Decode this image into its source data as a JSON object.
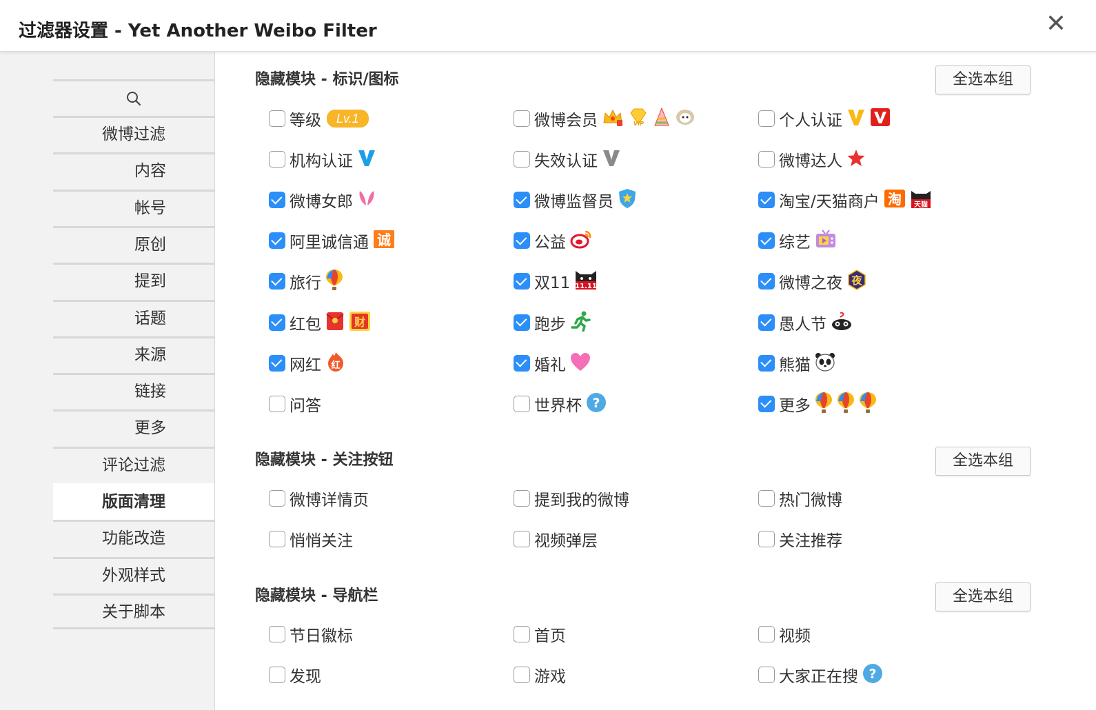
{
  "window": {
    "title": "过滤器设置 - Yet Another Weibo Filter",
    "close_label": "✕"
  },
  "sidebar": {
    "search_icon": "search-icon",
    "items": [
      {
        "label": "微博过滤",
        "level": "top",
        "active": false
      },
      {
        "label": "内容",
        "level": "sub",
        "active": false
      },
      {
        "label": "帐号",
        "level": "sub",
        "active": false
      },
      {
        "label": "原创",
        "level": "sub",
        "active": false
      },
      {
        "label": "提到",
        "level": "sub",
        "active": false
      },
      {
        "label": "话题",
        "level": "sub",
        "active": false
      },
      {
        "label": "来源",
        "level": "sub",
        "active": false
      },
      {
        "label": "链接",
        "level": "sub",
        "active": false
      },
      {
        "label": "更多",
        "level": "sub",
        "active": false
      },
      {
        "label": "评论过滤",
        "level": "top",
        "active": false
      },
      {
        "label": "版面清理",
        "level": "top",
        "active": true
      },
      {
        "label": "功能改造",
        "level": "top",
        "active": false
      },
      {
        "label": "外观样式",
        "level": "top",
        "active": false
      },
      {
        "label": "关于脚本",
        "level": "top",
        "active": false
      }
    ]
  },
  "groups": [
    {
      "title": "隐藏模块 - 标识/图标",
      "select_all_label": "全选本组",
      "options": [
        {
          "label": "等级",
          "checked": false,
          "badge": "Lv.1"
        },
        {
          "label": "微博会员",
          "checked": false,
          "icons": [
            "crown-icon",
            "vip-diamond-icon",
            "party-hat-icon",
            "sheep-icon"
          ]
        },
        {
          "label": "个人认证",
          "checked": false,
          "icons": [
            "verified-v-yellow-icon",
            "verified-v-red-icon"
          ]
        },
        {
          "label": "机构认证",
          "checked": false,
          "icons": [
            "verified-v-blue-icon"
          ]
        },
        {
          "label": "失效认证",
          "checked": false,
          "icons": [
            "verified-v-gray-icon"
          ]
        },
        {
          "label": "微博达人",
          "checked": false,
          "icons": [
            "star-icon"
          ]
        },
        {
          "label": "微博女郎",
          "checked": true,
          "icons": [
            "bunny-ears-icon"
          ]
        },
        {
          "label": "微博监督员",
          "checked": true,
          "icons": [
            "shield-star-icon"
          ]
        },
        {
          "label": "淘宝/天猫商户",
          "checked": true,
          "icons": [
            "taobao-icon",
            "tmall-icon"
          ],
          "icon_text": [
            "淘",
            "天猫"
          ]
        },
        {
          "label": "阿里诚信通",
          "checked": true,
          "icons": [
            "chengxin-icon"
          ],
          "icon_text": [
            "诚"
          ]
        },
        {
          "label": "公益",
          "checked": true,
          "icons": [
            "weibo-logo-icon"
          ]
        },
        {
          "label": "综艺",
          "checked": true,
          "icons": [
            "tv-icon"
          ]
        },
        {
          "label": "旅行",
          "checked": true,
          "icons": [
            "balloon-icon"
          ]
        },
        {
          "label": "双11",
          "checked": true,
          "icons": [
            "double11-cat-icon"
          ],
          "icon_text": [
            "11.11"
          ]
        },
        {
          "label": "微博之夜",
          "checked": true,
          "icons": [
            "night-icon"
          ],
          "icon_text": [
            "夜"
          ]
        },
        {
          "label": "红包",
          "checked": true,
          "icons": [
            "red-envelope-icon",
            "cai-icon"
          ],
          "icon_text": [
            "财"
          ]
        },
        {
          "label": "跑步",
          "checked": true,
          "icons": [
            "runner-icon"
          ]
        },
        {
          "label": "愚人节",
          "checked": true,
          "icons": [
            "april-fools-icon"
          ]
        },
        {
          "label": "网红",
          "checked": true,
          "icons": [
            "wanghong-icon"
          ],
          "icon_text": [
            "红"
          ]
        },
        {
          "label": "婚礼",
          "checked": true,
          "icons": [
            "heart-icon"
          ]
        },
        {
          "label": "熊猫",
          "checked": true,
          "icons": [
            "panda-icon"
          ]
        },
        {
          "label": "问答",
          "checked": false,
          "icons": []
        },
        {
          "label": "世界杯",
          "checked": false,
          "icons": [
            "help-icon"
          ],
          "icon_text": [
            "?"
          ]
        },
        {
          "label": "更多",
          "checked": true,
          "icons": [
            "balloon-icon",
            "balloon-icon",
            "balloon-icon"
          ]
        }
      ]
    },
    {
      "title": "隐藏模块 - 关注按钮",
      "select_all_label": "全选本组",
      "options": [
        {
          "label": "微博详情页",
          "checked": false,
          "icons": []
        },
        {
          "label": "提到我的微博",
          "checked": false,
          "icons": []
        },
        {
          "label": "热门微博",
          "checked": false,
          "icons": []
        },
        {
          "label": "悄悄关注",
          "checked": false,
          "icons": []
        },
        {
          "label": "视频弹层",
          "checked": false,
          "icons": []
        },
        {
          "label": "关注推荐",
          "checked": false,
          "icons": []
        }
      ]
    },
    {
      "title": "隐藏模块 - 导航栏",
      "select_all_label": "全选本组",
      "options": [
        {
          "label": "节日徽标",
          "checked": false,
          "icons": []
        },
        {
          "label": "首页",
          "checked": false,
          "icons": []
        },
        {
          "label": "视频",
          "checked": false,
          "icons": []
        },
        {
          "label": "发现",
          "checked": false,
          "icons": []
        },
        {
          "label": "游戏",
          "checked": false,
          "icons": []
        },
        {
          "label": "大家正在搜",
          "checked": false,
          "icons": [
            "help-icon"
          ],
          "icon_text": [
            "?"
          ]
        }
      ]
    }
  ],
  "colors": {
    "checkbox_on": "#2c8ef8",
    "accent_orange": "#f8b528",
    "sidebar_bg": "#f2f2f2"
  }
}
